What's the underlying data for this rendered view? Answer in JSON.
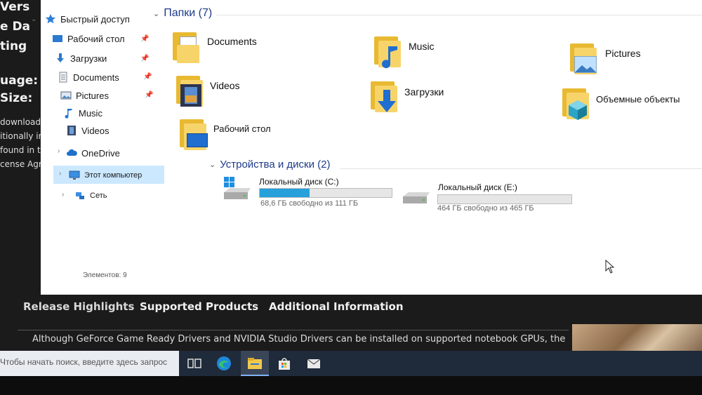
{
  "background_page": {
    "left_fragments": [
      "Vers",
      "e Da",
      "ting",
      "uage:",
      "Size:",
      "download",
      "itionally ins",
      "found in the",
      "cense Agreem"
    ],
    "tabs": [
      {
        "label": "Release Highlights",
        "color": "#d9d9d9"
      },
      {
        "label": "Supported Products",
        "color": "#f0f0f0"
      },
      {
        "label": "Additional Information",
        "color": "#f0f0f0"
      }
    ],
    "body_text": "Although GeForce Game Ready Drivers and NVIDIA Studio Drivers can be installed on supported notebook GPUs, the"
  },
  "sidebar": {
    "items": [
      {
        "label": "Быстрый доступ",
        "icon": "star-icon"
      },
      {
        "label": "Рабочий стол",
        "icon": "desktop-icon",
        "pinned": true
      },
      {
        "label": "Загрузки",
        "icon": "download-arrow-icon",
        "pinned": true
      },
      {
        "label": "Documents",
        "icon": "document-icon",
        "pinned": true
      },
      {
        "label": "Pictures",
        "icon": "picture-icon",
        "pinned": true
      },
      {
        "label": "Music",
        "icon": "music-note-icon"
      },
      {
        "label": "Videos",
        "icon": "film-icon"
      },
      {
        "label": "OneDrive",
        "icon": "cloud-icon"
      },
      {
        "label": "Этот компьютер",
        "icon": "computer-icon",
        "selected": true
      },
      {
        "label": "Сеть",
        "icon": "network-icon"
      }
    ]
  },
  "status": {
    "items_count": "Элементов: 9"
  },
  "folders_group": {
    "title": "Папки (7)",
    "folders": [
      {
        "label": "Documents",
        "icon": "documents-folder-icon"
      },
      {
        "label": "Music",
        "icon": "music-folder-icon"
      },
      {
        "label": "Pictures",
        "icon": "pictures-folder-icon"
      },
      {
        "label": "Videos",
        "icon": "videos-folder-icon"
      },
      {
        "label": "Загрузки",
        "icon": "downloads-folder-icon"
      },
      {
        "label": "Объемные объекты",
        "icon": "3d-objects-folder-icon"
      },
      {
        "label": "Рабочий стол",
        "icon": "desktop-folder-icon"
      }
    ]
  },
  "devices_group": {
    "title": "Устройства и диски (2)",
    "drives": [
      {
        "name": "Локальный диск (C:)",
        "free_text": "68,6 ГБ свободно из 111 ГБ",
        "used_fraction": 0.38,
        "icon": "windows-drive-icon"
      },
      {
        "name": "Локальный диск (E:)",
        "free_text": "464 ГБ свободно из 465 ГБ",
        "used_fraction": 0.0,
        "icon": "hard-drive-icon"
      }
    ]
  },
  "taskbar": {
    "search_placeholder": "Чтобы начать поиск, введите здесь запрос",
    "icons": [
      "task-view-icon",
      "edge-icon",
      "file-explorer-icon",
      "store-icon",
      "mail-icon"
    ]
  },
  "colors": {
    "accent": "#26a0da",
    "selection": "#cce8ff",
    "group_header": "#1e3a8a",
    "taskbar": "#1f2a3a"
  }
}
